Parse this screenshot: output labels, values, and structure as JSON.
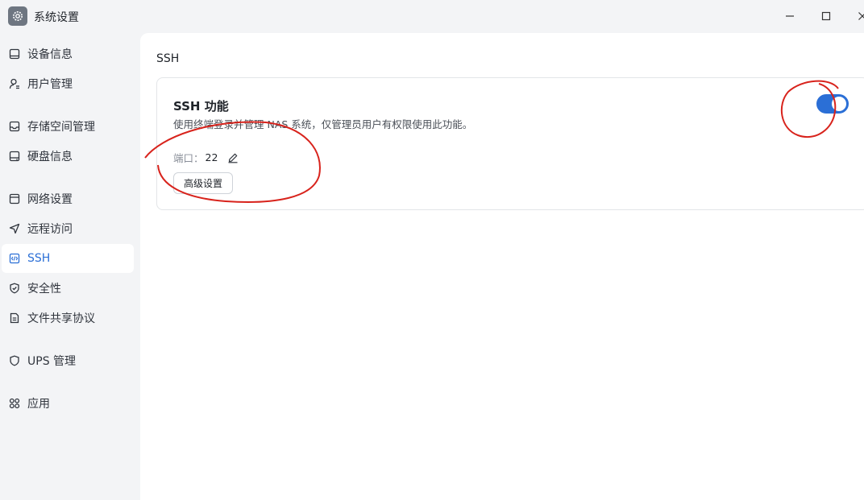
{
  "window": {
    "title": "系统设置",
    "app_icon": "gear-icon",
    "controls": [
      "minimize-icon",
      "maximize-icon",
      "close-icon"
    ]
  },
  "sidebar": {
    "items": [
      {
        "label": "设备信息",
        "icon": "device-icon"
      },
      {
        "label": "用户管理",
        "icon": "user-icon"
      },
      {
        "label": "存储空间管理",
        "icon": "storage-icon"
      },
      {
        "label": "硬盘信息",
        "icon": "disk-icon"
      },
      {
        "label": "网络设置",
        "icon": "network-icon"
      },
      {
        "label": "远程访问",
        "icon": "send-icon"
      },
      {
        "label": "SSH",
        "icon": "code-icon",
        "active": true
      },
      {
        "label": "安全性",
        "icon": "shield-check-icon"
      },
      {
        "label": "文件共享协议",
        "icon": "document-icon"
      },
      {
        "label": "UPS 管理",
        "icon": "shield-icon"
      },
      {
        "label": "应用",
        "icon": "apps-icon"
      }
    ]
  },
  "main": {
    "section_title": "SSH",
    "card": {
      "title": "SSH 功能",
      "description": "使用终端登录并管理 NAS 系统，仅管理员用户有权限使用此功能。",
      "port_label": "端口：",
      "port_value": "22",
      "advanced_button": "高级设置",
      "enabled": true
    }
  },
  "colors": {
    "accent": "#2b6fd6",
    "sidebar_bg": "#f3f4f6",
    "annotation": "#d8231c"
  }
}
